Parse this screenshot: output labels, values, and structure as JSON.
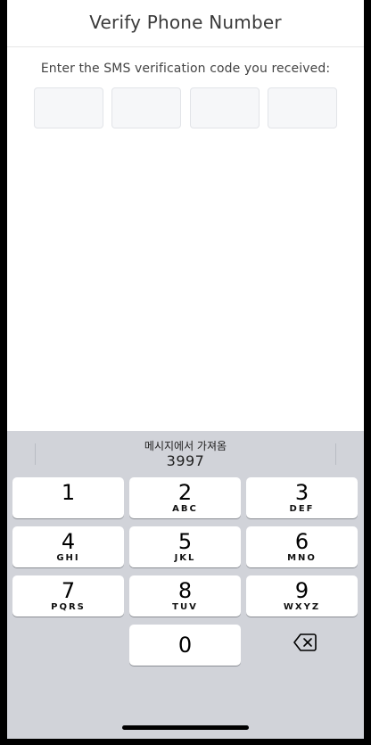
{
  "header": {
    "title": "Verify Phone Number"
  },
  "prompt": "Enter the SMS verification code you received:",
  "code_fields": [
    "",
    "",
    "",
    ""
  ],
  "keyboard": {
    "suggestion_label": "메시지에서 가져옴",
    "suggestion_code": "3997",
    "keys": [
      {
        "num": "1",
        "letters": ""
      },
      {
        "num": "2",
        "letters": "ABC"
      },
      {
        "num": "3",
        "letters": "DEF"
      },
      {
        "num": "4",
        "letters": "GHI"
      },
      {
        "num": "5",
        "letters": "JKL"
      },
      {
        "num": "6",
        "letters": "MNO"
      },
      {
        "num": "7",
        "letters": "PQRS"
      },
      {
        "num": "8",
        "letters": "TUV"
      },
      {
        "num": "9",
        "letters": "WXYZ"
      },
      {
        "num": "0",
        "letters": ""
      }
    ],
    "backspace_icon": "backspace-icon"
  }
}
